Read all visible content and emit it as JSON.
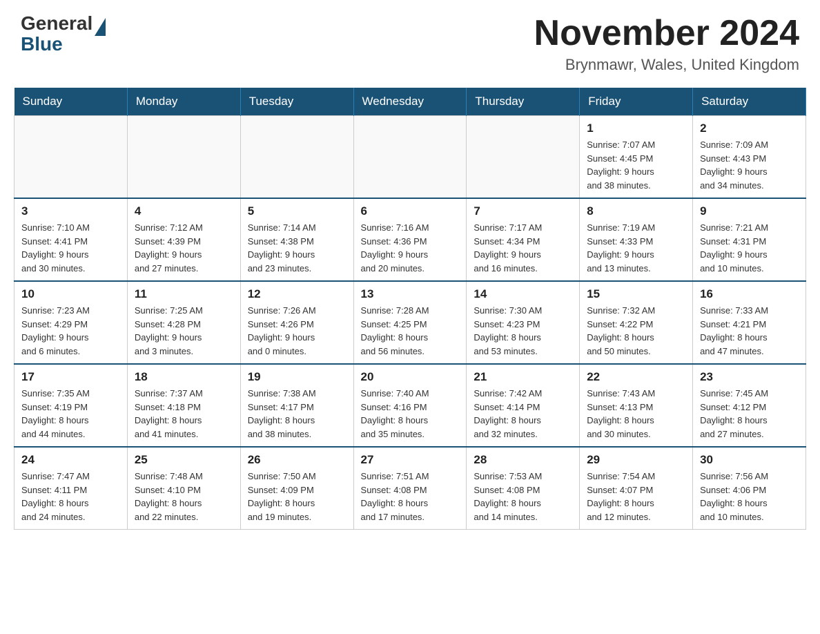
{
  "header": {
    "logo_general": "General",
    "logo_blue": "Blue",
    "title": "November 2024",
    "location": "Brynmawr, Wales, United Kingdom"
  },
  "days_of_week": [
    "Sunday",
    "Monday",
    "Tuesday",
    "Wednesday",
    "Thursday",
    "Friday",
    "Saturday"
  ],
  "weeks": [
    [
      {
        "day": "",
        "info": ""
      },
      {
        "day": "",
        "info": ""
      },
      {
        "day": "",
        "info": ""
      },
      {
        "day": "",
        "info": ""
      },
      {
        "day": "",
        "info": ""
      },
      {
        "day": "1",
        "info": "Sunrise: 7:07 AM\nSunset: 4:45 PM\nDaylight: 9 hours\nand 38 minutes."
      },
      {
        "day": "2",
        "info": "Sunrise: 7:09 AM\nSunset: 4:43 PM\nDaylight: 9 hours\nand 34 minutes."
      }
    ],
    [
      {
        "day": "3",
        "info": "Sunrise: 7:10 AM\nSunset: 4:41 PM\nDaylight: 9 hours\nand 30 minutes."
      },
      {
        "day": "4",
        "info": "Sunrise: 7:12 AM\nSunset: 4:39 PM\nDaylight: 9 hours\nand 27 minutes."
      },
      {
        "day": "5",
        "info": "Sunrise: 7:14 AM\nSunset: 4:38 PM\nDaylight: 9 hours\nand 23 minutes."
      },
      {
        "day": "6",
        "info": "Sunrise: 7:16 AM\nSunset: 4:36 PM\nDaylight: 9 hours\nand 20 minutes."
      },
      {
        "day": "7",
        "info": "Sunrise: 7:17 AM\nSunset: 4:34 PM\nDaylight: 9 hours\nand 16 minutes."
      },
      {
        "day": "8",
        "info": "Sunrise: 7:19 AM\nSunset: 4:33 PM\nDaylight: 9 hours\nand 13 minutes."
      },
      {
        "day": "9",
        "info": "Sunrise: 7:21 AM\nSunset: 4:31 PM\nDaylight: 9 hours\nand 10 minutes."
      }
    ],
    [
      {
        "day": "10",
        "info": "Sunrise: 7:23 AM\nSunset: 4:29 PM\nDaylight: 9 hours\nand 6 minutes."
      },
      {
        "day": "11",
        "info": "Sunrise: 7:25 AM\nSunset: 4:28 PM\nDaylight: 9 hours\nand 3 minutes."
      },
      {
        "day": "12",
        "info": "Sunrise: 7:26 AM\nSunset: 4:26 PM\nDaylight: 9 hours\nand 0 minutes."
      },
      {
        "day": "13",
        "info": "Sunrise: 7:28 AM\nSunset: 4:25 PM\nDaylight: 8 hours\nand 56 minutes."
      },
      {
        "day": "14",
        "info": "Sunrise: 7:30 AM\nSunset: 4:23 PM\nDaylight: 8 hours\nand 53 minutes."
      },
      {
        "day": "15",
        "info": "Sunrise: 7:32 AM\nSunset: 4:22 PM\nDaylight: 8 hours\nand 50 minutes."
      },
      {
        "day": "16",
        "info": "Sunrise: 7:33 AM\nSunset: 4:21 PM\nDaylight: 8 hours\nand 47 minutes."
      }
    ],
    [
      {
        "day": "17",
        "info": "Sunrise: 7:35 AM\nSunset: 4:19 PM\nDaylight: 8 hours\nand 44 minutes."
      },
      {
        "day": "18",
        "info": "Sunrise: 7:37 AM\nSunset: 4:18 PM\nDaylight: 8 hours\nand 41 minutes."
      },
      {
        "day": "19",
        "info": "Sunrise: 7:38 AM\nSunset: 4:17 PM\nDaylight: 8 hours\nand 38 minutes."
      },
      {
        "day": "20",
        "info": "Sunrise: 7:40 AM\nSunset: 4:16 PM\nDaylight: 8 hours\nand 35 minutes."
      },
      {
        "day": "21",
        "info": "Sunrise: 7:42 AM\nSunset: 4:14 PM\nDaylight: 8 hours\nand 32 minutes."
      },
      {
        "day": "22",
        "info": "Sunrise: 7:43 AM\nSunset: 4:13 PM\nDaylight: 8 hours\nand 30 minutes."
      },
      {
        "day": "23",
        "info": "Sunrise: 7:45 AM\nSunset: 4:12 PM\nDaylight: 8 hours\nand 27 minutes."
      }
    ],
    [
      {
        "day": "24",
        "info": "Sunrise: 7:47 AM\nSunset: 4:11 PM\nDaylight: 8 hours\nand 24 minutes."
      },
      {
        "day": "25",
        "info": "Sunrise: 7:48 AM\nSunset: 4:10 PM\nDaylight: 8 hours\nand 22 minutes."
      },
      {
        "day": "26",
        "info": "Sunrise: 7:50 AM\nSunset: 4:09 PM\nDaylight: 8 hours\nand 19 minutes."
      },
      {
        "day": "27",
        "info": "Sunrise: 7:51 AM\nSunset: 4:08 PM\nDaylight: 8 hours\nand 17 minutes."
      },
      {
        "day": "28",
        "info": "Sunrise: 7:53 AM\nSunset: 4:08 PM\nDaylight: 8 hours\nand 14 minutes."
      },
      {
        "day": "29",
        "info": "Sunrise: 7:54 AM\nSunset: 4:07 PM\nDaylight: 8 hours\nand 12 minutes."
      },
      {
        "day": "30",
        "info": "Sunrise: 7:56 AM\nSunset: 4:06 PM\nDaylight: 8 hours\nand 10 minutes."
      }
    ]
  ]
}
